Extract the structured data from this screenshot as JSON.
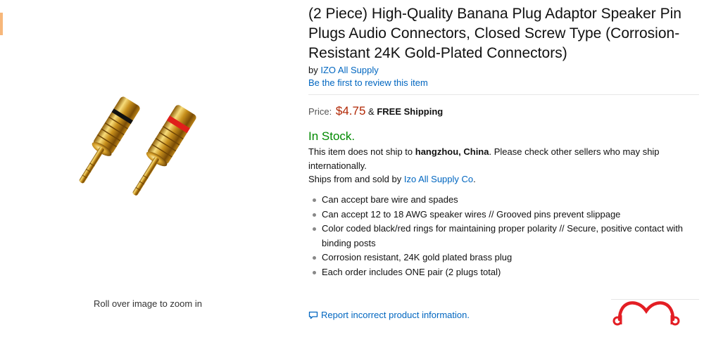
{
  "product": {
    "title": "(2 Piece) High-Quality Banana Plug Adaptor Speaker Pin Plugs Audio Connectors, Closed Screw Type (Corrosion-Resistant 24K Gold-Plated Connectors)",
    "by_prefix": "by",
    "brand": "IZO All Supply",
    "review_link": "Be the first to review this item",
    "price_label": "Price:",
    "price": "$4.75",
    "amp": "&",
    "shipping": "FREE Shipping",
    "stock": "In Stock.",
    "ship_note_pre": "This item does not ship to",
    "ship_location": "hangzhou, China",
    "ship_note_post": ". Please check other sellers who may ship internationally.",
    "ships_from_prefix": "Ships from and sold by",
    "seller": "Izo All Supply Co",
    "ships_from_suffix": ".",
    "features": [
      "Can accept bare wire and spades",
      "Can accept 12 to 18 AWG speaker wires // Grooved pins prevent slippage",
      "Color coded black/red rings for maintaining proper polarity // Secure, positive contact with binding posts",
      "Corrosion resistant, 24K gold plated brass plug",
      "Each order includes ONE pair (2 plugs total)"
    ],
    "report_link": "Report incorrect product information."
  },
  "image": {
    "zoom_hint": "Roll over image to zoom in",
    "icon": "banana-plug-product-photo"
  },
  "colors": {
    "link": "#0066c0",
    "price": "#b12704",
    "stock": "#008a00",
    "logo": "#e31e24",
    "gold": "#d9a520",
    "red_ring": "#e0201b"
  }
}
